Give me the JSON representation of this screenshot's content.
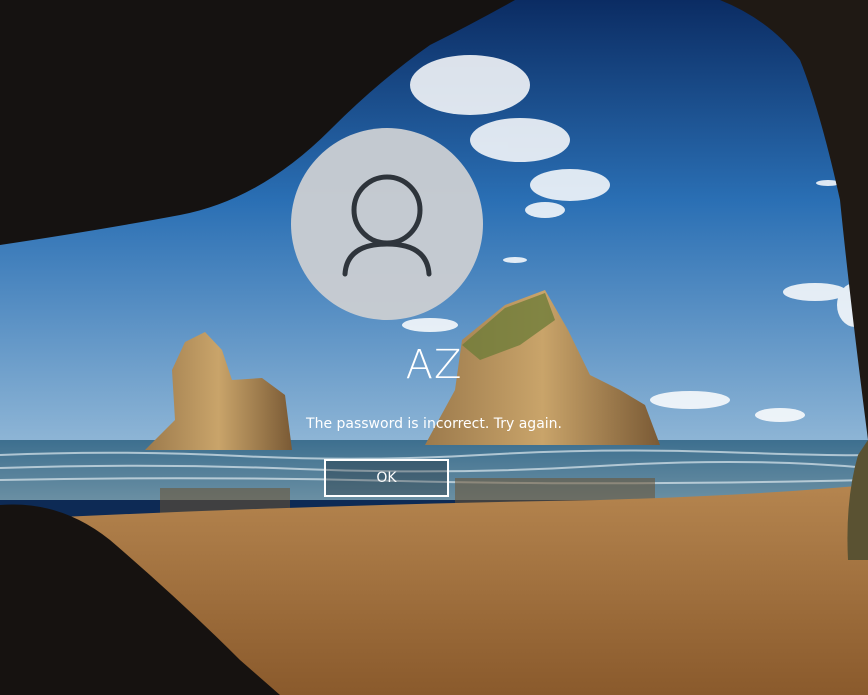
{
  "lockscreen": {
    "username": "AZ",
    "error_message": "The password is incorrect. Try again.",
    "ok_label": "OK",
    "avatar_icon": "user-icon",
    "background": "beach-cave-wallpaper"
  },
  "colors": {
    "sky_top": "#0b2c63",
    "sky_mid": "#2a6fb4",
    "sky_horizon": "#8fb6d6",
    "sand": "#b07a44",
    "avatar_bg": "#c9cdd2",
    "avatar_icon": "#2f3338",
    "text": "#ffffff"
  }
}
